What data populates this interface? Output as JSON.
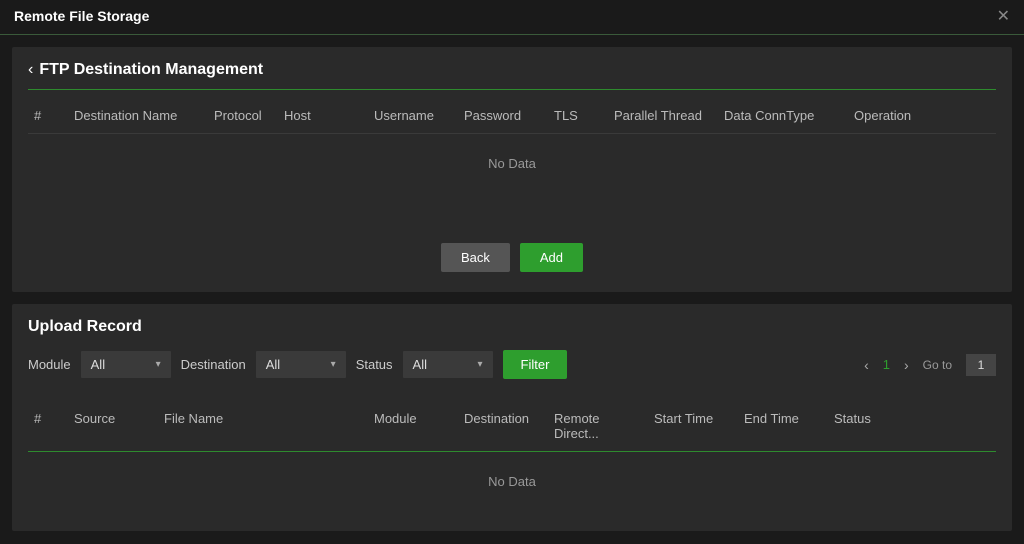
{
  "topbar": {
    "title": "Remote File Storage"
  },
  "ftp": {
    "title": "FTP Destination Management",
    "columns": [
      "#",
      "Destination Name",
      "Protocol",
      "Host",
      "Username",
      "Password",
      "TLS",
      "Parallel Thread",
      "Data ConnType",
      "Operation"
    ],
    "no_data": "No Data",
    "back_label": "Back",
    "add_label": "Add"
  },
  "upload": {
    "title": "Upload Record",
    "module_label": "Module",
    "destination_label": "Destination",
    "status_label": "Status",
    "module_value": "All",
    "destination_value": "All",
    "status_value": "All",
    "filter_label": "Filter",
    "go_to_label": "Go to",
    "page_current": "1",
    "go_to_value": "1",
    "columns": [
      "#",
      "Source",
      "File Name",
      "Module",
      "Destination",
      "Remote Direct...",
      "Start Time",
      "End Time",
      "Status"
    ],
    "no_data": "No Data"
  }
}
